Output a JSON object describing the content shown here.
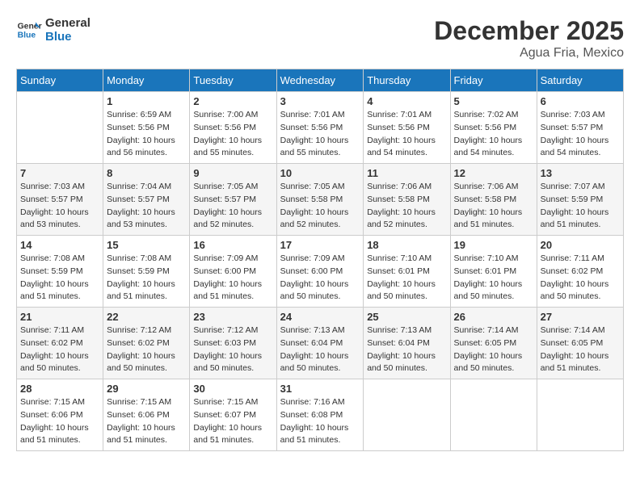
{
  "logo": {
    "line1": "General",
    "line2": "Blue"
  },
  "title": "December 2025",
  "location": "Agua Fria, Mexico",
  "days_of_week": [
    "Sunday",
    "Monday",
    "Tuesday",
    "Wednesday",
    "Thursday",
    "Friday",
    "Saturday"
  ],
  "weeks": [
    [
      {
        "num": "",
        "info": ""
      },
      {
        "num": "1",
        "info": "Sunrise: 6:59 AM\nSunset: 5:56 PM\nDaylight: 10 hours\nand 56 minutes."
      },
      {
        "num": "2",
        "info": "Sunrise: 7:00 AM\nSunset: 5:56 PM\nDaylight: 10 hours\nand 55 minutes."
      },
      {
        "num": "3",
        "info": "Sunrise: 7:01 AM\nSunset: 5:56 PM\nDaylight: 10 hours\nand 55 minutes."
      },
      {
        "num": "4",
        "info": "Sunrise: 7:01 AM\nSunset: 5:56 PM\nDaylight: 10 hours\nand 54 minutes."
      },
      {
        "num": "5",
        "info": "Sunrise: 7:02 AM\nSunset: 5:56 PM\nDaylight: 10 hours\nand 54 minutes."
      },
      {
        "num": "6",
        "info": "Sunrise: 7:03 AM\nSunset: 5:57 PM\nDaylight: 10 hours\nand 54 minutes."
      }
    ],
    [
      {
        "num": "7",
        "info": "Sunrise: 7:03 AM\nSunset: 5:57 PM\nDaylight: 10 hours\nand 53 minutes."
      },
      {
        "num": "8",
        "info": "Sunrise: 7:04 AM\nSunset: 5:57 PM\nDaylight: 10 hours\nand 53 minutes."
      },
      {
        "num": "9",
        "info": "Sunrise: 7:05 AM\nSunset: 5:57 PM\nDaylight: 10 hours\nand 52 minutes."
      },
      {
        "num": "10",
        "info": "Sunrise: 7:05 AM\nSunset: 5:58 PM\nDaylight: 10 hours\nand 52 minutes."
      },
      {
        "num": "11",
        "info": "Sunrise: 7:06 AM\nSunset: 5:58 PM\nDaylight: 10 hours\nand 52 minutes."
      },
      {
        "num": "12",
        "info": "Sunrise: 7:06 AM\nSunset: 5:58 PM\nDaylight: 10 hours\nand 51 minutes."
      },
      {
        "num": "13",
        "info": "Sunrise: 7:07 AM\nSunset: 5:59 PM\nDaylight: 10 hours\nand 51 minutes."
      }
    ],
    [
      {
        "num": "14",
        "info": "Sunrise: 7:08 AM\nSunset: 5:59 PM\nDaylight: 10 hours\nand 51 minutes."
      },
      {
        "num": "15",
        "info": "Sunrise: 7:08 AM\nSunset: 5:59 PM\nDaylight: 10 hours\nand 51 minutes."
      },
      {
        "num": "16",
        "info": "Sunrise: 7:09 AM\nSunset: 6:00 PM\nDaylight: 10 hours\nand 51 minutes."
      },
      {
        "num": "17",
        "info": "Sunrise: 7:09 AM\nSunset: 6:00 PM\nDaylight: 10 hours\nand 50 minutes."
      },
      {
        "num": "18",
        "info": "Sunrise: 7:10 AM\nSunset: 6:01 PM\nDaylight: 10 hours\nand 50 minutes."
      },
      {
        "num": "19",
        "info": "Sunrise: 7:10 AM\nSunset: 6:01 PM\nDaylight: 10 hours\nand 50 minutes."
      },
      {
        "num": "20",
        "info": "Sunrise: 7:11 AM\nSunset: 6:02 PM\nDaylight: 10 hours\nand 50 minutes."
      }
    ],
    [
      {
        "num": "21",
        "info": "Sunrise: 7:11 AM\nSunset: 6:02 PM\nDaylight: 10 hours\nand 50 minutes."
      },
      {
        "num": "22",
        "info": "Sunrise: 7:12 AM\nSunset: 6:02 PM\nDaylight: 10 hours\nand 50 minutes."
      },
      {
        "num": "23",
        "info": "Sunrise: 7:12 AM\nSunset: 6:03 PM\nDaylight: 10 hours\nand 50 minutes."
      },
      {
        "num": "24",
        "info": "Sunrise: 7:13 AM\nSunset: 6:04 PM\nDaylight: 10 hours\nand 50 minutes."
      },
      {
        "num": "25",
        "info": "Sunrise: 7:13 AM\nSunset: 6:04 PM\nDaylight: 10 hours\nand 50 minutes."
      },
      {
        "num": "26",
        "info": "Sunrise: 7:14 AM\nSunset: 6:05 PM\nDaylight: 10 hours\nand 50 minutes."
      },
      {
        "num": "27",
        "info": "Sunrise: 7:14 AM\nSunset: 6:05 PM\nDaylight: 10 hours\nand 51 minutes."
      }
    ],
    [
      {
        "num": "28",
        "info": "Sunrise: 7:15 AM\nSunset: 6:06 PM\nDaylight: 10 hours\nand 51 minutes."
      },
      {
        "num": "29",
        "info": "Sunrise: 7:15 AM\nSunset: 6:06 PM\nDaylight: 10 hours\nand 51 minutes."
      },
      {
        "num": "30",
        "info": "Sunrise: 7:15 AM\nSunset: 6:07 PM\nDaylight: 10 hours\nand 51 minutes."
      },
      {
        "num": "31",
        "info": "Sunrise: 7:16 AM\nSunset: 6:08 PM\nDaylight: 10 hours\nand 51 minutes."
      },
      {
        "num": "",
        "info": ""
      },
      {
        "num": "",
        "info": ""
      },
      {
        "num": "",
        "info": ""
      }
    ]
  ]
}
